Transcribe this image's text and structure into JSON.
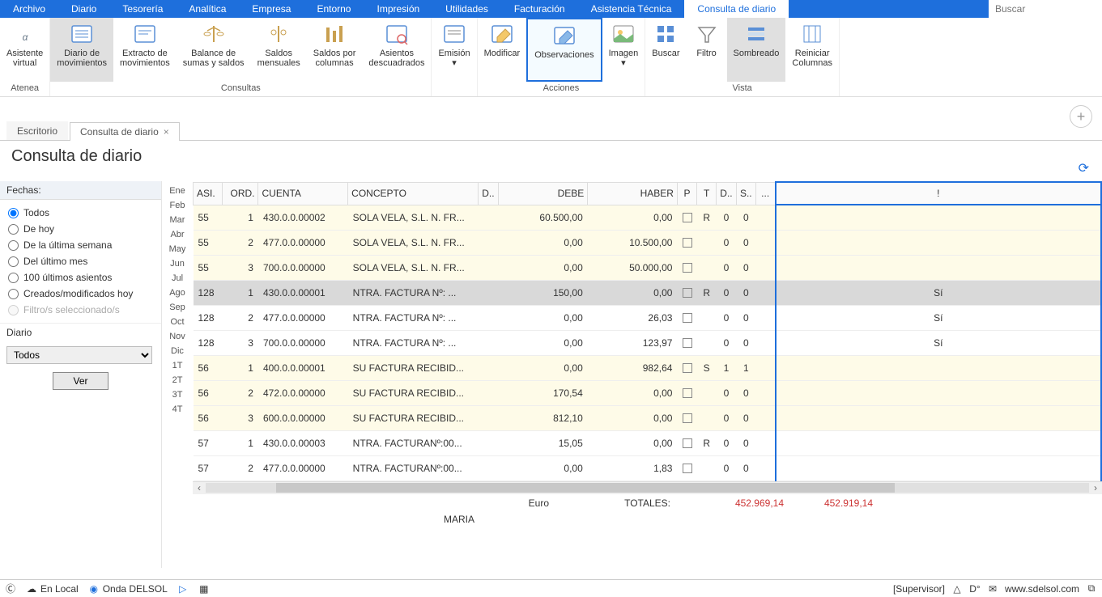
{
  "menu": [
    "Archivo",
    "Diario",
    "Tesorería",
    "Analítica",
    "Empresa",
    "Entorno",
    "Impresión",
    "Utilidades",
    "Facturación",
    "Asistencia Técnica",
    "Consulta de diario"
  ],
  "menu_active_index": 10,
  "search_placeholder": "Buscar",
  "ribbon": {
    "groups": [
      {
        "label": "Atenea",
        "items": [
          {
            "label": "Asistente\nvirtual",
            "name": "asistente-virtual"
          }
        ]
      },
      {
        "label": "Consultas",
        "items": [
          {
            "label": "Diario de\nmovimientos",
            "name": "diario-de-movimientos",
            "highlighted": true
          },
          {
            "label": "Extracto de\nmovimientos",
            "name": "extracto-de-movimientos"
          },
          {
            "label": "Balance de\nsumas y saldos",
            "name": "balance-sumas-saldos"
          },
          {
            "label": "Saldos\nmensuales",
            "name": "saldos-mensuales"
          },
          {
            "label": "Saldos por\ncolumnas",
            "name": "saldos-por-columnas"
          },
          {
            "label": "Asientos\ndescuadrados",
            "name": "asientos-descuadrados"
          }
        ]
      },
      {
        "label": "",
        "items": [
          {
            "label": "Emisión\n▾",
            "name": "emision"
          }
        ]
      },
      {
        "label": "Acciones",
        "items": [
          {
            "label": "Modificar",
            "name": "modificar"
          },
          {
            "label": "Observaciones",
            "name": "observaciones",
            "selected": true
          },
          {
            "label": "Imagen\n▾",
            "name": "imagen"
          }
        ]
      },
      {
        "label": "Vista",
        "items": [
          {
            "label": "Buscar",
            "name": "buscar"
          },
          {
            "label": "Filtro",
            "name": "filtro"
          },
          {
            "label": "Sombreado",
            "name": "sombreado",
            "shaded": true
          },
          {
            "label": "Reiniciar\nColumnas",
            "name": "reiniciar-columnas"
          }
        ]
      }
    ]
  },
  "tabs": [
    {
      "label": "Escritorio",
      "closable": false,
      "active": false
    },
    {
      "label": "Consulta de diario",
      "closable": true,
      "active": true
    }
  ],
  "page_title": "Consulta de diario",
  "sidebar": {
    "fechas_label": "Fechas:",
    "radios": [
      {
        "label": "Todos",
        "checked": true
      },
      {
        "label": "De hoy",
        "checked": false
      },
      {
        "label": "De la última semana",
        "checked": false
      },
      {
        "label": "Del último mes",
        "checked": false
      },
      {
        "label": "100 últimos asientos",
        "checked": false
      },
      {
        "label": "Creados/modificados hoy",
        "checked": false
      },
      {
        "label": "Filtro/s seleccionado/s",
        "checked": false,
        "disabled": true
      }
    ],
    "diario_label": "Diario",
    "diario_value": "Todos",
    "ver_label": "Ver"
  },
  "months": [
    "Ene",
    "Feb",
    "Mar",
    "Abr",
    "May",
    "Jun",
    "Jul",
    "Ago",
    "Sep",
    "Oct",
    "Nov",
    "Dic",
    "1T",
    "2T",
    "3T",
    "4T"
  ],
  "columns": [
    "ASI.",
    "ORD.",
    "CUENTA",
    "CONCEPTO",
    "D..",
    "DEBE",
    "HABER",
    "P",
    "T",
    "D..",
    "S..",
    "...",
    "!"
  ],
  "rows": [
    {
      "asi": "55",
      "ord": "1",
      "cuenta": "430.0.0.00002",
      "concepto": "SOLA VELA, S.L. N. FR...",
      "d": "",
      "debe": "60.500,00",
      "haber": "0,00",
      "p_check": true,
      "t": "R",
      "d2": "0",
      "s": "0",
      "bang": "",
      "cls": "cream"
    },
    {
      "asi": "55",
      "ord": "2",
      "cuenta": "477.0.0.00000",
      "concepto": "SOLA VELA, S.L. N. FR...",
      "d": "",
      "debe": "0,00",
      "haber": "10.500,00",
      "p_check": true,
      "t": "",
      "d2": "0",
      "s": "0",
      "bang": "",
      "cls": "cream"
    },
    {
      "asi": "55",
      "ord": "3",
      "cuenta": "700.0.0.00000",
      "concepto": "SOLA VELA, S.L. N. FR...",
      "d": "",
      "debe": "0,00",
      "haber": "50.000,00",
      "p_check": true,
      "t": "",
      "d2": "0",
      "s": "0",
      "bang": "",
      "cls": "cream"
    },
    {
      "asi": "128",
      "ord": "1",
      "cuenta": "430.0.0.00001",
      "concepto": "NTRA. FACTURA Nº:  ...",
      "d": "",
      "debe": "150,00",
      "haber": "0,00",
      "p_check": true,
      "t": "R",
      "d2": "0",
      "s": "0",
      "bang": "Sí",
      "cls": "selected"
    },
    {
      "asi": "128",
      "ord": "2",
      "cuenta": "477.0.0.00000",
      "concepto": "NTRA. FACTURA Nº:  ...",
      "d": "",
      "debe": "0,00",
      "haber": "26,03",
      "p_check": true,
      "t": "",
      "d2": "0",
      "s": "0",
      "bang": "Sí",
      "cls": "white"
    },
    {
      "asi": "128",
      "ord": "3",
      "cuenta": "700.0.0.00000",
      "concepto": "NTRA. FACTURA Nº:  ...",
      "d": "",
      "debe": "0,00",
      "haber": "123,97",
      "p_check": true,
      "t": "",
      "d2": "0",
      "s": "0",
      "bang": "Sí",
      "cls": "white"
    },
    {
      "asi": "56",
      "ord": "1",
      "cuenta": "400.0.0.00001",
      "concepto": "SU FACTURA RECIBID...",
      "d": "",
      "debe": "0,00",
      "haber": "982,64",
      "p_check": true,
      "t": "S",
      "d2": "1",
      "s": "1",
      "bang": "",
      "cls": "cream"
    },
    {
      "asi": "56",
      "ord": "2",
      "cuenta": "472.0.0.00000",
      "concepto": "SU FACTURA RECIBID...",
      "d": "",
      "debe": "170,54",
      "haber": "0,00",
      "p_check": true,
      "t": "",
      "d2": "0",
      "s": "0",
      "bang": "",
      "cls": "cream"
    },
    {
      "asi": "56",
      "ord": "3",
      "cuenta": "600.0.0.00000",
      "concepto": "SU FACTURA RECIBID...",
      "d": "",
      "debe": "812,10",
      "haber": "0,00",
      "p_check": true,
      "t": "",
      "d2": "0",
      "s": "0",
      "bang": "",
      "cls": "cream"
    },
    {
      "asi": "57",
      "ord": "1",
      "cuenta": "430.0.0.00003",
      "concepto": "NTRA. FACTURANº:00...",
      "d": "",
      "debe": "15,05",
      "haber": "0,00",
      "p_check": true,
      "t": "R",
      "d2": "0",
      "s": "0",
      "bang": "",
      "cls": "white"
    },
    {
      "asi": "57",
      "ord": "2",
      "cuenta": "477.0.0.00000",
      "concepto": "NTRA. FACTURANº:00...",
      "d": "",
      "debe": "0,00",
      "haber": "1,83",
      "p_check": true,
      "t": "",
      "d2": "0",
      "s": "0",
      "bang": "",
      "cls": "white"
    }
  ],
  "totals": {
    "currency": "Euro",
    "label": "TOTALES:",
    "debe": "452.969,14",
    "haber": "452.919,14"
  },
  "user": "MARIA",
  "statusbar": {
    "local": "En Local",
    "onda": "Onda DELSOL",
    "supervisor": "[Supervisor]",
    "url": "www.sdelsol.com"
  }
}
